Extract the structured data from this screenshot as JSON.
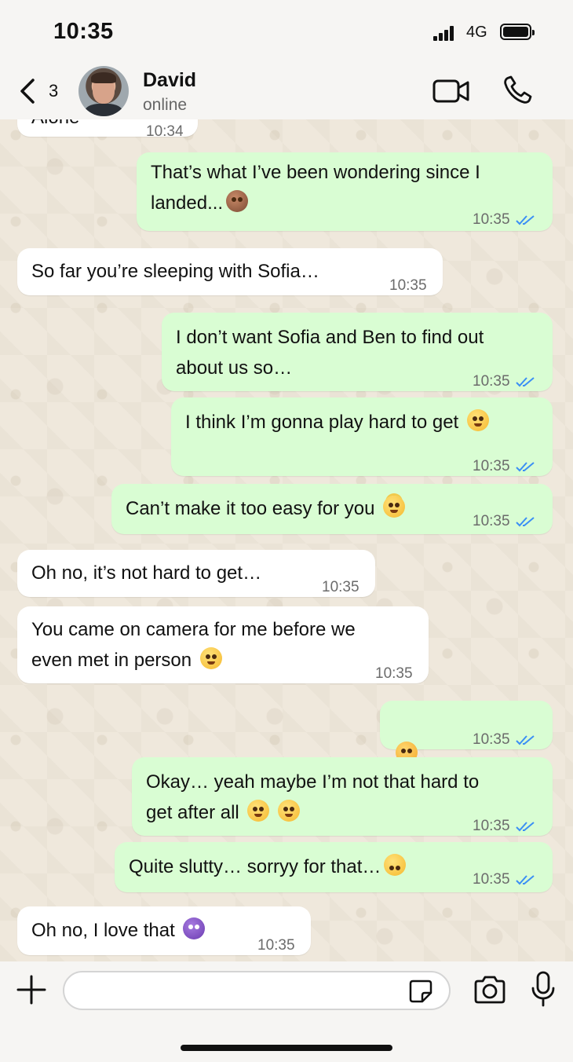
{
  "status_bar": {
    "time": "10:35",
    "network": "4G"
  },
  "header": {
    "back_count": "3",
    "contact_name": "David",
    "contact_status": "online",
    "icons": [
      "back-chevron-icon",
      "video-camera-icon",
      "phone-icon"
    ]
  },
  "messages": [
    {
      "direction": "in",
      "text": "Alone",
      "time": "10:34",
      "partial": true
    },
    {
      "direction": "out",
      "text": "That’s what I’ve been wondering since I\nlanded...",
      "emoji": "see-no-evil-monkey",
      "time": "10:35",
      "read": true
    },
    {
      "direction": "in",
      "text": "So far you’re sleeping with Sofia…",
      "time": "10:35"
    },
    {
      "direction": "out",
      "text": "I don’t want Sofia and Ben to find out\nabout us so…",
      "time": "10:35",
      "read": true
    },
    {
      "direction": "out",
      "text": "I think I’m gonna play hard to get",
      "emoji": "smiling-face",
      "time": "10:35",
      "read": true
    },
    {
      "direction": "out",
      "text": "Can’t make it too easy for you",
      "emoji": "smiling-face-with-halo",
      "time": "10:35",
      "read": true
    },
    {
      "direction": "in",
      "text": "Oh no, it’s not hard to get…",
      "time": "10:35"
    },
    {
      "direction": "in",
      "text": "You came on camera for me before we\neven met in person",
      "emoji": "relieved-face",
      "time": "10:35"
    },
    {
      "direction": "out",
      "text": "",
      "emoji": "flushed-faces",
      "time": "10:35",
      "read": true
    },
    {
      "direction": "out",
      "text": "Okay… yeah maybe I’m not that hard to\nget after all",
      "emoji": "grinning-sweat-face",
      "time": "10:35",
      "read": true
    },
    {
      "direction": "out",
      "text": "Quite slutty… sorryy for that…",
      "emoji": "upside-down-face",
      "time": "10:35",
      "read": true
    },
    {
      "direction": "in",
      "text": "Oh no, I love that",
      "emoji": "smiling-devil",
      "time": "10:35"
    }
  ],
  "input_bar": {
    "placeholder": "",
    "icons": [
      "plus-icon",
      "sticker-icon",
      "camera-icon",
      "microphone-icon"
    ]
  },
  "colors": {
    "outgoing_bubble": "#d9fdd3",
    "incoming_bubble": "#ffffff",
    "read_ticks": "#3b8ff5",
    "chat_background": "#efe8dc"
  }
}
